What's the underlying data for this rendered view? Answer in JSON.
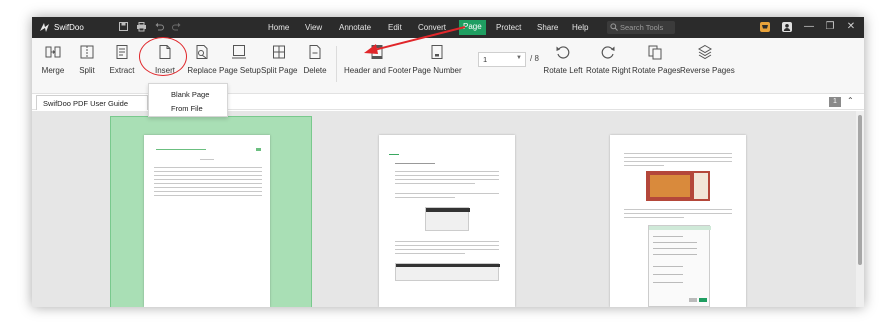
{
  "app": {
    "name": "SwifDoo"
  },
  "menu": [
    {
      "label": "Home"
    },
    {
      "label": "View"
    },
    {
      "label": "Annotate"
    },
    {
      "label": "Edit"
    },
    {
      "label": "Convert"
    },
    {
      "label": "Page",
      "active": true
    },
    {
      "label": "Protect"
    },
    {
      "label": "Share"
    },
    {
      "label": "Help"
    }
  ],
  "search": {
    "placeholder": "Search Tools"
  },
  "ribbon": {
    "merge": "Merge",
    "split": "Split",
    "extract": "Extract",
    "insert": "Insert",
    "replace": "Replace",
    "page_setup": "Page Setup",
    "split_page": "Split Page",
    "delete": "Delete",
    "header_footer": "Header and Footer",
    "page_number": "Page Number",
    "page_current": "1",
    "page_total": "/ 8",
    "rotate_left": "Rotate Left",
    "rotate_right": "Rotate Right",
    "rotate_pages": "Rotate Pages",
    "reverse_pages": "Reverse Pages"
  },
  "insert_menu": {
    "blank_page": "Blank Page",
    "from_file": "From File"
  },
  "tab": {
    "title": "SwifDoo PDF User Guide",
    "count": "1"
  },
  "colors": {
    "accent": "#1f9e61",
    "annotation": "#e0262a",
    "titlebar": "#2b2b2b",
    "selection": "#a9dfb5"
  }
}
